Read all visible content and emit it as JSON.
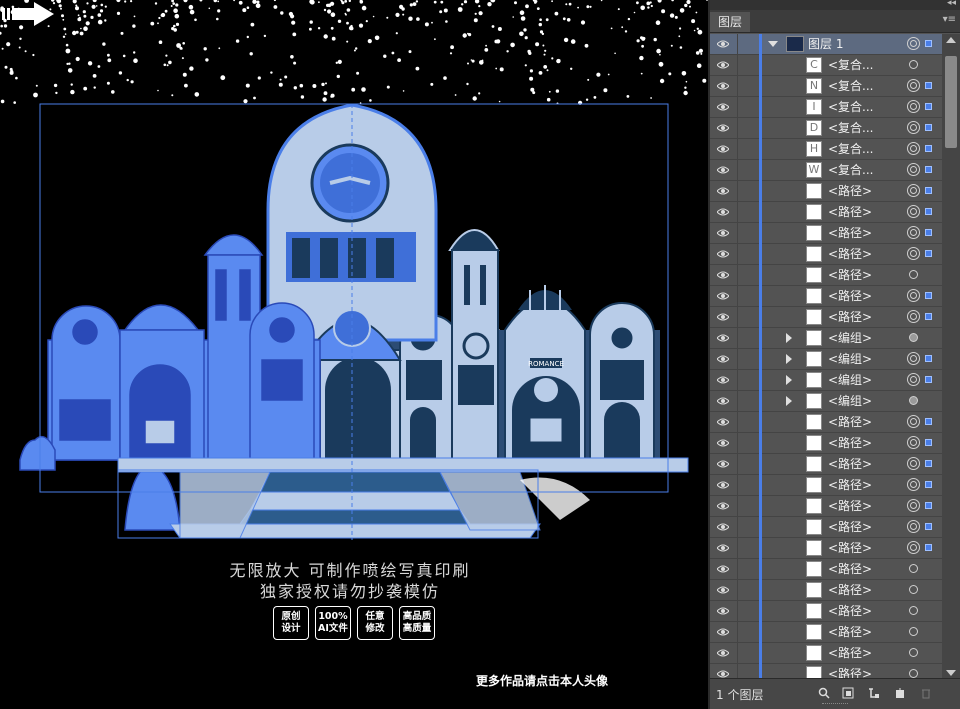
{
  "artwork": {
    "tagline_line1": "无限放大  可制作喷绘写真印刷",
    "tagline_line2": "独家授权请勿抄袭模仿",
    "badges": [
      {
        "line1": "原创",
        "line2": "设计"
      },
      {
        "line1": "100%",
        "line2": "AI文件"
      },
      {
        "line1": "任意",
        "line2": "修改"
      },
      {
        "line1": "高品质",
        "line2": "高质量"
      }
    ],
    "more_text": "更多作品请点击本人头像",
    "sign_text": "ROMANCE"
  },
  "layers_panel": {
    "tab_label": "图层",
    "footer_count": "1 个图层",
    "parent_layer": {
      "name": "图层 1"
    },
    "rows": [
      {
        "name": "<复合...",
        "thumb": "C",
        "target": "plain",
        "selected": false,
        "expand": false
      },
      {
        "name": "<复合...",
        "thumb": "N",
        "target": "appearance",
        "selected": true,
        "expand": false
      },
      {
        "name": "<复合...",
        "thumb": "I",
        "target": "appearance",
        "selected": true,
        "expand": false
      },
      {
        "name": "<复合...",
        "thumb": "D",
        "target": "appearance",
        "selected": true,
        "expand": false
      },
      {
        "name": "<复合...",
        "thumb": "H",
        "target": "appearance",
        "selected": true,
        "expand": false
      },
      {
        "name": "<复合...",
        "thumb": "W",
        "target": "appearance",
        "selected": true,
        "expand": false
      },
      {
        "name": "<路径>",
        "thumb": "",
        "target": "appearance",
        "selected": true,
        "expand": false
      },
      {
        "name": "<路径>",
        "thumb": "",
        "target": "appearance",
        "selected": true,
        "expand": false
      },
      {
        "name": "<路径>",
        "thumb": "",
        "target": "appearance",
        "selected": true,
        "expand": false
      },
      {
        "name": "<路径>",
        "thumb": "",
        "target": "appearance",
        "selected": true,
        "expand": false
      },
      {
        "name": "<路径>",
        "thumb": "",
        "target": "plain",
        "selected": false,
        "expand": false
      },
      {
        "name": "<路径>",
        "thumb": "",
        "target": "appearance",
        "selected": true,
        "expand": false
      },
      {
        "name": "<路径>",
        "thumb": "",
        "target": "appearance",
        "selected": true,
        "expand": false
      },
      {
        "name": "<编组>",
        "thumb": "",
        "target": "filled",
        "selected": false,
        "expand": true
      },
      {
        "name": "<编组>",
        "thumb": "",
        "target": "appearance",
        "selected": true,
        "expand": true
      },
      {
        "name": "<编组>",
        "thumb": "",
        "target": "appearance",
        "selected": true,
        "expand": true
      },
      {
        "name": "<编组>",
        "thumb": "",
        "target": "filled",
        "selected": false,
        "expand": true
      },
      {
        "name": "<路径>",
        "thumb": "",
        "target": "appearance",
        "selected": true,
        "expand": false
      },
      {
        "name": "<路径>",
        "thumb": "",
        "target": "appearance",
        "selected": true,
        "expand": false
      },
      {
        "name": "<路径>",
        "thumb": "",
        "target": "appearance",
        "selected": true,
        "expand": false
      },
      {
        "name": "<路径>",
        "thumb": "",
        "target": "appearance",
        "selected": true,
        "expand": false
      },
      {
        "name": "<路径>",
        "thumb": "",
        "target": "appearance",
        "selected": true,
        "expand": false
      },
      {
        "name": "<路径>",
        "thumb": "",
        "target": "appearance",
        "selected": true,
        "expand": false
      },
      {
        "name": "<路径>",
        "thumb": "",
        "target": "appearance",
        "selected": true,
        "expand": false
      },
      {
        "name": "<路径>",
        "thumb": "",
        "target": "plain",
        "selected": false,
        "expand": false
      },
      {
        "name": "<路径>",
        "thumb": "",
        "target": "plain",
        "selected": false,
        "expand": false
      },
      {
        "name": "<路径>",
        "thumb": "",
        "target": "plain",
        "selected": false,
        "expand": false
      },
      {
        "name": "<路径>",
        "thumb": "",
        "target": "plain",
        "selected": false,
        "expand": false
      },
      {
        "name": "<路径>",
        "thumb": "",
        "target": "plain",
        "selected": false,
        "expand": false
      },
      {
        "name": "<路径>",
        "thumb": "",
        "target": "plain",
        "selected": false,
        "expand": false
      }
    ]
  },
  "colors": {
    "selection_blue": "#4a7ee8",
    "castle_light": "#b8cce8",
    "castle_dark": "#1a3a5c",
    "castle_selected": "#5a8af0"
  }
}
